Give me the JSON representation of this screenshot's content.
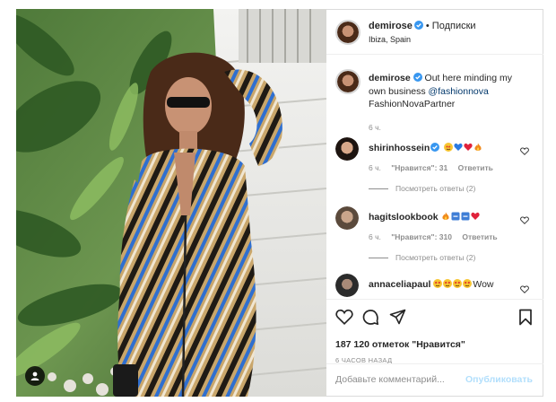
{
  "post": {
    "author": "demirose",
    "separator": "•",
    "follow_label": "Подписки",
    "location": "Ibiza, Spain"
  },
  "caption": {
    "username": "demirose",
    "text_before": "Out here minding my own business",
    "mention": "@fashionnova",
    "text_after": "FashionNovaPartner",
    "time": "6 ч."
  },
  "comments": [
    {
      "username": "shirinhossein",
      "verified": true,
      "emojis": [
        "starstruck-face",
        "blue-heart",
        "red-heart",
        "fire"
      ],
      "text": "",
      "time": "6 ч.",
      "likes_label": "\"Нравится\": 31",
      "reply_label": "Ответить",
      "view_replies": "Посмотреть ответы (2)"
    },
    {
      "username": "hagitslookbook",
      "verified": false,
      "emojis": [
        "fire",
        "blue-square",
        "blue-square",
        "red-heart"
      ],
      "text": "",
      "time": "6 ч.",
      "likes_label": "\"Нравится\": 310",
      "reply_label": "Ответить",
      "view_replies": "Посмотреть ответы (2)"
    },
    {
      "username": "annaceliapaul",
      "verified": false,
      "emojis": [
        "starstruck-face",
        "starstruck-face",
        "starstruck-face",
        "starstruck-face"
      ],
      "text": "Wow"
    }
  ],
  "actions": {
    "likes_text": "187 120 отметок \"Нравится\"",
    "timestamp": "6 ЧАСОВ НАЗАД"
  },
  "add_comment": {
    "placeholder": "Добавьте комментарий...",
    "post_label": "Опубликовать"
  },
  "colors": {
    "link": "#00376b",
    "muted": "#8e8e8e",
    "verified": "#3897f0",
    "post_disabled": "#b2dffc"
  }
}
